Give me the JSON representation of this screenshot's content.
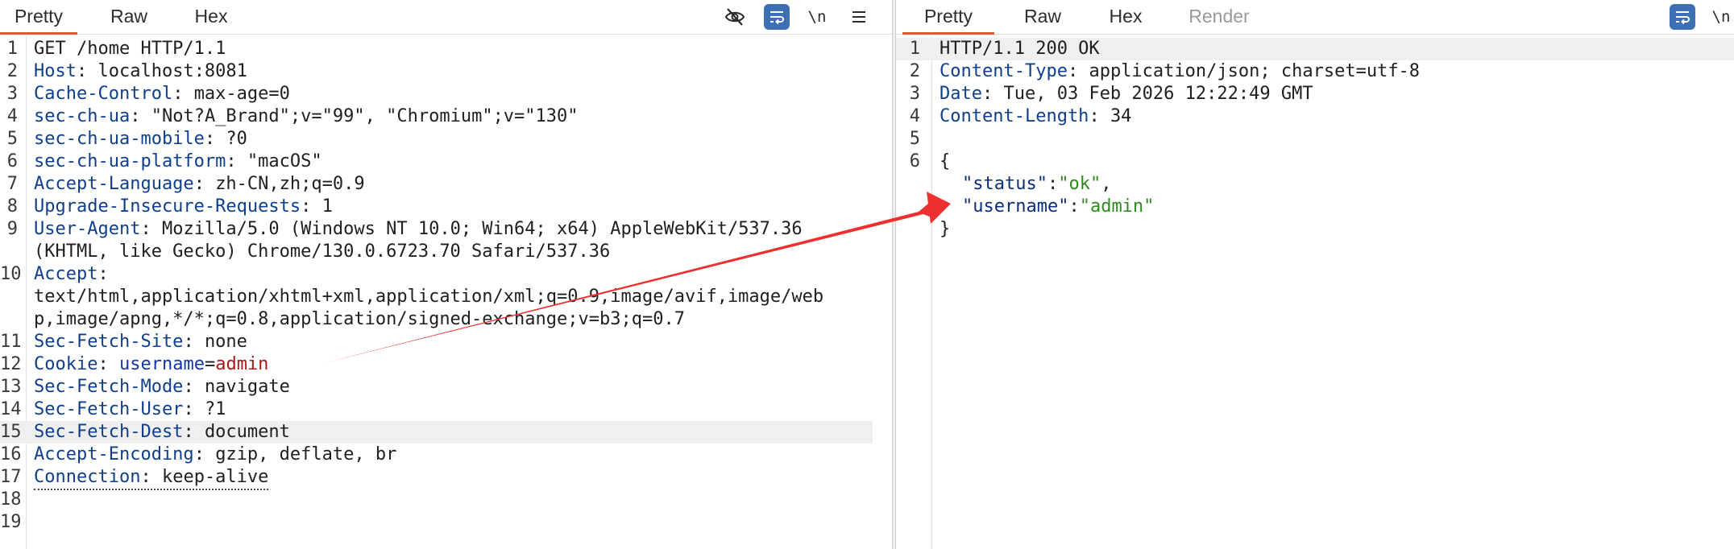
{
  "request": {
    "tabs": [
      {
        "label": "Pretty",
        "active": true
      },
      {
        "label": "Raw",
        "active": false
      },
      {
        "label": "Hex",
        "active": false
      }
    ],
    "toolbar": [
      {
        "icon": "eye-off-icon",
        "selected": false
      },
      {
        "icon": "wrap-lines-icon",
        "selected": true
      },
      {
        "icon": "newline-icon",
        "label": "\\n",
        "selected": false
      },
      {
        "icon": "menu-icon",
        "selected": false
      }
    ],
    "lines": [
      {
        "n": "1",
        "name": "",
        "sep": "",
        "value": "GET /home HTTP/1.1"
      },
      {
        "n": "2",
        "name": "Host",
        "sep": ": ",
        "value": "localhost:8081"
      },
      {
        "n": "3",
        "name": "Cache-Control",
        "sep": ": ",
        "value": "max-age=0"
      },
      {
        "n": "4",
        "name": "sec-ch-ua",
        "sep": ": ",
        "value": "\"Not?A_Brand\";v=\"99\", \"Chromium\";v=\"130\""
      },
      {
        "n": "5",
        "name": "sec-ch-ua-mobile",
        "sep": ": ",
        "value": "?0"
      },
      {
        "n": "6",
        "name": "sec-ch-ua-platform",
        "sep": ": ",
        "value": "\"macOS\""
      },
      {
        "n": "7",
        "name": "Accept-Language",
        "sep": ": ",
        "value": "zh-CN,zh;q=0.9"
      },
      {
        "n": "8",
        "name": "Upgrade-Insecure-Requests",
        "sep": ": ",
        "value": "1"
      },
      {
        "n": "9",
        "name": "User-Agent",
        "sep": ": ",
        "value": "Mozilla/5.0 (Windows NT 10.0; Win64; x64) AppleWebKit/537.36"
      },
      {
        "n": "",
        "name": "",
        "sep": "",
        "value": "(KHTML, like Gecko) Chrome/130.0.6723.70 Safari/537.36"
      },
      {
        "n": "10",
        "name": "Accept",
        "sep": ":",
        "value": ""
      },
      {
        "n": "",
        "name": "",
        "sep": "",
        "value": "text/html,application/xhtml+xml,application/xml;q=0.9,image/avif,image/web"
      },
      {
        "n": "",
        "name": "",
        "sep": "",
        "value": "p,image/apng,*/*;q=0.8,application/signed-exchange;v=b3;q=0.7"
      },
      {
        "n": "11",
        "name": "Sec-Fetch-Site",
        "sep": ": ",
        "value": "none"
      },
      {
        "n": "12",
        "name": "Cookie",
        "sep": ": ",
        "cookie_name": "username",
        "cookie_eq": "=",
        "cookie_value": "admin"
      },
      {
        "n": "13",
        "name": "Sec-Fetch-Mode",
        "sep": ": ",
        "value": "navigate"
      },
      {
        "n": "14",
        "name": "Sec-Fetch-User",
        "sep": ": ",
        "value": "?1"
      },
      {
        "n": "15",
        "name": "Sec-Fetch-Dest",
        "sep": ": ",
        "value": "document",
        "highlight": true
      },
      {
        "n": "16",
        "name": "Accept-Encoding",
        "sep": ": ",
        "value": "gzip, deflate, br"
      },
      {
        "n": "17",
        "name": "Connection",
        "sep": ": ",
        "value": "keep-alive",
        "dotted": true
      },
      {
        "n": "18",
        "name": "",
        "sep": "",
        "value": ""
      },
      {
        "n": "19",
        "name": "",
        "sep": "",
        "value": ""
      }
    ]
  },
  "response": {
    "tabs": [
      {
        "label": "Pretty",
        "active": true
      },
      {
        "label": "Raw",
        "active": false
      },
      {
        "label": "Hex",
        "active": false
      },
      {
        "label": "Render",
        "active": false,
        "disabled": true
      }
    ],
    "toolbar": [
      {
        "icon": "wrap-lines-icon",
        "selected": true
      },
      {
        "icon": "newline-icon",
        "label": "\\n",
        "selected": false
      }
    ],
    "lines": [
      {
        "n": "1",
        "name": "",
        "sep": "",
        "value": "HTTP/1.1 200 OK"
      },
      {
        "n": "2",
        "name": "Content-Type",
        "sep": ": ",
        "value": "application/json; charset=utf-8"
      },
      {
        "n": "3",
        "name": "Date",
        "sep": ": ",
        "value": "Tue, 03 Feb 2026 12:22:49 GMT"
      },
      {
        "n": "4",
        "name": "Content-Length",
        "sep": ": ",
        "value": "34"
      },
      {
        "n": "5",
        "name": "",
        "sep": "",
        "value": ""
      },
      {
        "n": "6",
        "name": "",
        "sep": "",
        "value": "{"
      },
      {
        "n": "",
        "json_key": "\"status\"",
        "colon": ":",
        "json_value": "\"ok\"",
        "tail": ","
      },
      {
        "n": "",
        "json_key": "\"username\"",
        "colon": ":",
        "json_value": "\"admin\"",
        "tail": ""
      },
      {
        "n": "",
        "name": "",
        "sep": "",
        "value": "}"
      }
    ]
  },
  "colors": {
    "active_tab_underline": "#e8562d",
    "selected_tool": "#3f6fb3",
    "header_name": "#0f3f8c",
    "cookie_value": "#a81818",
    "json_string": "#2c8a1e",
    "annotation_arrow": "#ee2f2f"
  }
}
